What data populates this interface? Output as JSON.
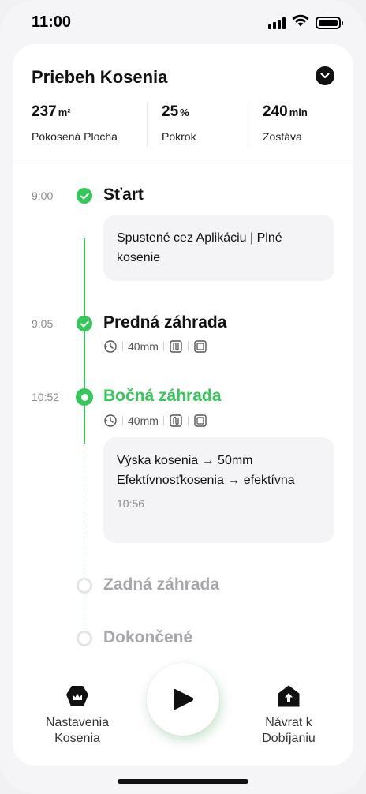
{
  "status_bar": {
    "time": "11:00",
    "icons": [
      "signal-icon",
      "wifi-icon",
      "battery-icon"
    ]
  },
  "header": {
    "title": "Priebeh Kosenia",
    "collapse_icon": "chevron-down-icon"
  },
  "stats": [
    {
      "value": "237",
      "unit": "m²",
      "label": "Pokosená Plocha"
    },
    {
      "value": "25",
      "unit": "%",
      "label": "Pokrok"
    },
    {
      "value": "240",
      "unit": "min",
      "label": "Zostáva"
    }
  ],
  "timeline": [
    {
      "time": "9:00",
      "title": "Start",
      "title_display": "Sťart",
      "state": "done",
      "note": "Spustené cez Aplikáciu | Plné kosenie"
    },
    {
      "time": "9:05",
      "title": "Predná záhrada",
      "state": "done",
      "meta": {
        "height": "40mm",
        "icons": [
          "blade-speed-icon",
          "pattern-icon",
          "edge-icon"
        ]
      }
    },
    {
      "time": "10:52",
      "title": "Bočná záhrada",
      "state": "active",
      "meta": {
        "height": "40mm",
        "icons": [
          "blade-speed-icon",
          "pattern-icon",
          "edge-icon"
        ]
      },
      "note_lines": [
        "Výska kosenia → 50mm",
        "Efektívnosťkosenia → efektívna"
      ],
      "note_time": "10:56"
    },
    {
      "title": "Zadná záhrada",
      "state": "pending"
    },
    {
      "title": "Dokončené",
      "state": "pending"
    }
  ],
  "bottom_nav": {
    "left": {
      "label_line1": "Nastavenia",
      "label_line2": "Kosenia",
      "icon": "crown-icon"
    },
    "center": {
      "icon": "play-icon"
    },
    "right": {
      "label_line1": "Návrat k",
      "label_line2": "Dobíjaniu",
      "icon": "home-icon"
    }
  },
  "colors": {
    "accent": "#34c759",
    "text": "#111111",
    "muted": "#8b8b90",
    "pending": "#a6a6ab"
  }
}
